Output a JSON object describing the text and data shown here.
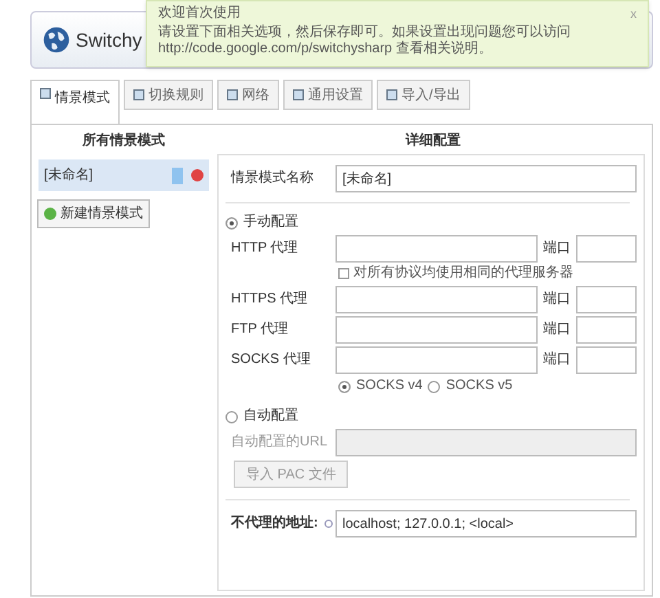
{
  "header": {
    "title": "Switchy"
  },
  "notification": {
    "title": "欢迎首次使用",
    "message": "请设置下面相关选项，然后保存即可。如果设置出现问题您可以访问 http://code.google.com/p/switchysharp 查看相关说明。",
    "close": "x"
  },
  "tabs": [
    {
      "label": "情景模式",
      "selected": true
    },
    {
      "label": "切换规则",
      "selected": false
    },
    {
      "label": "网络",
      "selected": false
    },
    {
      "label": "通用设置",
      "selected": false
    },
    {
      "label": "导入/导出",
      "selected": false
    }
  ],
  "profiles": {
    "heading": "所有情景模式",
    "items": [
      {
        "name": "[未命名]",
        "color": "#8fc3ef",
        "selected": true
      }
    ],
    "new_button": "新建情景模式"
  },
  "details": {
    "heading": "详细配置",
    "name_label": "情景模式名称",
    "name_value": "[未命名]",
    "manual": {
      "label": "手动配置",
      "selected": true,
      "proxies": [
        {
          "label": "HTTP 代理",
          "port_label": "端口"
        }
      ],
      "same_proxy": {
        "label": "对所有协议均使用相同的代理服务器",
        "checked": false
      },
      "other_proxies": [
        {
          "label": "HTTPS 代理",
          "port_label": "端口"
        },
        {
          "label": "FTP 代理",
          "port_label": "端口"
        },
        {
          "label": "SOCKS 代理",
          "port_label": "端口"
        }
      ],
      "socks_versions": [
        {
          "label": "SOCKS v4",
          "selected": true
        },
        {
          "label": "SOCKS v5",
          "selected": false
        }
      ]
    },
    "auto": {
      "label": "自动配置",
      "selected": false,
      "url_label": "自动配置的URL",
      "import_button": "导入 PAC 文件"
    },
    "bypass": {
      "label": "不代理的地址:",
      "value": "localhost; 127.0.0.1; <local>"
    }
  }
}
